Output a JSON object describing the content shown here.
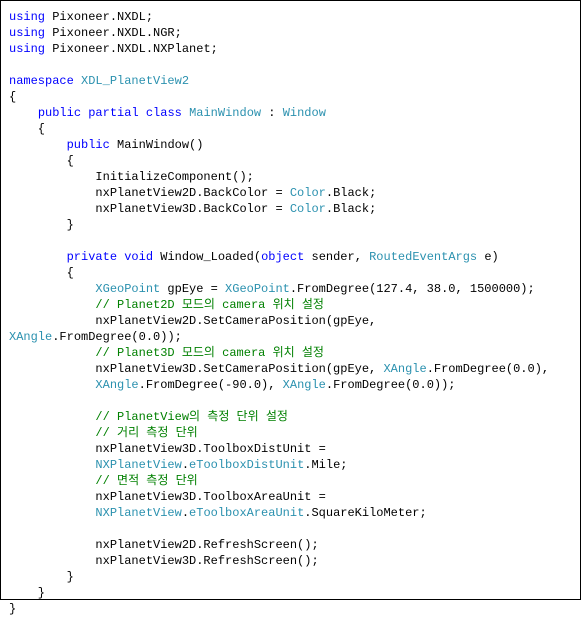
{
  "code_lines": [
    {
      "segments": [
        {
          "text": "using",
          "class": "keyword"
        },
        {
          "text": " Pixoneer.NXDL;",
          "class": "plain"
        }
      ]
    },
    {
      "segments": [
        {
          "text": "using",
          "class": "keyword"
        },
        {
          "text": " Pixoneer.NXDL.NGR;",
          "class": "plain"
        }
      ]
    },
    {
      "segments": [
        {
          "text": "using",
          "class": "keyword"
        },
        {
          "text": " Pixoneer.NXDL.NXPlanet;",
          "class": "plain"
        }
      ]
    },
    {
      "segments": [
        {
          "text": " ",
          "class": "plain"
        }
      ]
    },
    {
      "segments": [
        {
          "text": "namespace",
          "class": "keyword"
        },
        {
          "text": " ",
          "class": "plain"
        },
        {
          "text": "XDL_PlanetView2",
          "class": "type"
        }
      ]
    },
    {
      "segments": [
        {
          "text": "{",
          "class": "plain"
        }
      ]
    },
    {
      "segments": [
        {
          "text": "    ",
          "class": "plain"
        },
        {
          "text": "public",
          "class": "keyword"
        },
        {
          "text": " ",
          "class": "plain"
        },
        {
          "text": "partial",
          "class": "keyword"
        },
        {
          "text": " ",
          "class": "plain"
        },
        {
          "text": "class",
          "class": "keyword"
        },
        {
          "text": " ",
          "class": "plain"
        },
        {
          "text": "MainWindow",
          "class": "type"
        },
        {
          "text": " : ",
          "class": "plain"
        },
        {
          "text": "Window",
          "class": "type"
        }
      ]
    },
    {
      "segments": [
        {
          "text": "    {",
          "class": "plain"
        }
      ]
    },
    {
      "segments": [
        {
          "text": "        ",
          "class": "plain"
        },
        {
          "text": "public",
          "class": "keyword"
        },
        {
          "text": " MainWindow()",
          "class": "plain"
        }
      ]
    },
    {
      "segments": [
        {
          "text": "        {",
          "class": "plain"
        }
      ]
    },
    {
      "segments": [
        {
          "text": "            InitializeComponent();",
          "class": "plain"
        }
      ]
    },
    {
      "segments": [
        {
          "text": "            nxPlanetView2D.BackColor = ",
          "class": "plain"
        },
        {
          "text": "Color",
          "class": "type"
        },
        {
          "text": ".Black;",
          "class": "plain"
        }
      ]
    },
    {
      "segments": [
        {
          "text": "            nxPlanetView3D.BackColor = ",
          "class": "plain"
        },
        {
          "text": "Color",
          "class": "type"
        },
        {
          "text": ".Black;",
          "class": "plain"
        }
      ]
    },
    {
      "segments": [
        {
          "text": "        }",
          "class": "plain"
        }
      ]
    },
    {
      "segments": [
        {
          "text": " ",
          "class": "plain"
        }
      ]
    },
    {
      "segments": [
        {
          "text": "        ",
          "class": "plain"
        },
        {
          "text": "private",
          "class": "keyword"
        },
        {
          "text": " ",
          "class": "plain"
        },
        {
          "text": "void",
          "class": "keyword"
        },
        {
          "text": " Window_Loaded(",
          "class": "plain"
        },
        {
          "text": "object",
          "class": "keyword"
        },
        {
          "text": " sender, ",
          "class": "plain"
        },
        {
          "text": "RoutedEventArgs",
          "class": "type"
        },
        {
          "text": " e)",
          "class": "plain"
        }
      ]
    },
    {
      "segments": [
        {
          "text": "        {",
          "class": "plain"
        }
      ]
    },
    {
      "segments": [
        {
          "text": "            ",
          "class": "plain"
        },
        {
          "text": "XGeoPoint",
          "class": "type"
        },
        {
          "text": " gpEye = ",
          "class": "plain"
        },
        {
          "text": "XGeoPoint",
          "class": "type"
        },
        {
          "text": ".FromDegree(127.4, 38.0, 1500000);",
          "class": "plain"
        }
      ]
    },
    {
      "segments": [
        {
          "text": "            ",
          "class": "plain"
        },
        {
          "text": "// Planet2D 모드의 camera 위치 설정",
          "class": "comment"
        }
      ]
    },
    {
      "segments": [
        {
          "text": "            nxPlanetView2D.SetCameraPosition(gpEye, ",
          "class": "plain"
        }
      ]
    },
    {
      "segments": [
        {
          "text": "XAngle",
          "class": "type"
        },
        {
          "text": ".FromDegree(0.0));",
          "class": "plain"
        }
      ]
    },
    {
      "segments": [
        {
          "text": "            ",
          "class": "plain"
        },
        {
          "text": "// Planet3D 모드의 camera 위치 설정",
          "class": "comment"
        }
      ]
    },
    {
      "segments": [
        {
          "text": "            nxPlanetView3D.SetCameraPosition(gpEye, ",
          "class": "plain"
        },
        {
          "text": "XAngle",
          "class": "type"
        },
        {
          "text": ".FromDegree(0.0), ",
          "class": "plain"
        }
      ]
    },
    {
      "segments": [
        {
          "text": "            ",
          "class": "plain"
        },
        {
          "text": "XAngle",
          "class": "type"
        },
        {
          "text": ".FromDegree(-90.0), ",
          "class": "plain"
        },
        {
          "text": "XAngle",
          "class": "type"
        },
        {
          "text": ".FromDegree(0.0));",
          "class": "plain"
        }
      ]
    },
    {
      "segments": [
        {
          "text": " ",
          "class": "plain"
        }
      ]
    },
    {
      "segments": [
        {
          "text": "            ",
          "class": "plain"
        },
        {
          "text": "// PlanetView의 측정 단위 설정",
          "class": "comment"
        }
      ]
    },
    {
      "segments": [
        {
          "text": "            ",
          "class": "plain"
        },
        {
          "text": "// 거리 측정 단위",
          "class": "comment"
        }
      ]
    },
    {
      "segments": [
        {
          "text": "            nxPlanetView3D.ToolboxDistUnit = ",
          "class": "plain"
        }
      ]
    },
    {
      "segments": [
        {
          "text": "            ",
          "class": "plain"
        },
        {
          "text": "NXPlanetView",
          "class": "type"
        },
        {
          "text": ".",
          "class": "plain"
        },
        {
          "text": "eToolboxDistUnit",
          "class": "type"
        },
        {
          "text": ".Mile;",
          "class": "plain"
        }
      ]
    },
    {
      "segments": [
        {
          "text": "            ",
          "class": "plain"
        },
        {
          "text": "// 면적 측정 단위",
          "class": "comment"
        }
      ]
    },
    {
      "segments": [
        {
          "text": "            nxPlanetView3D.ToolboxAreaUnit = ",
          "class": "plain"
        }
      ]
    },
    {
      "segments": [
        {
          "text": "            ",
          "class": "plain"
        },
        {
          "text": "NXPlanetView",
          "class": "type"
        },
        {
          "text": ".",
          "class": "plain"
        },
        {
          "text": "eToolboxAreaUnit",
          "class": "type"
        },
        {
          "text": ".SquareKiloMeter;",
          "class": "plain"
        }
      ]
    },
    {
      "segments": [
        {
          "text": " ",
          "class": "plain"
        }
      ]
    },
    {
      "segments": [
        {
          "text": "            nxPlanetView2D.RefreshScreen();",
          "class": "plain"
        }
      ]
    },
    {
      "segments": [
        {
          "text": "            nxPlanetView3D.RefreshScreen();",
          "class": "plain"
        }
      ]
    },
    {
      "segments": [
        {
          "text": "        }",
          "class": "plain"
        }
      ]
    },
    {
      "segments": [
        {
          "text": "    }",
          "class": "plain"
        }
      ]
    },
    {
      "segments": [
        {
          "text": "}",
          "class": "plain"
        }
      ]
    }
  ]
}
